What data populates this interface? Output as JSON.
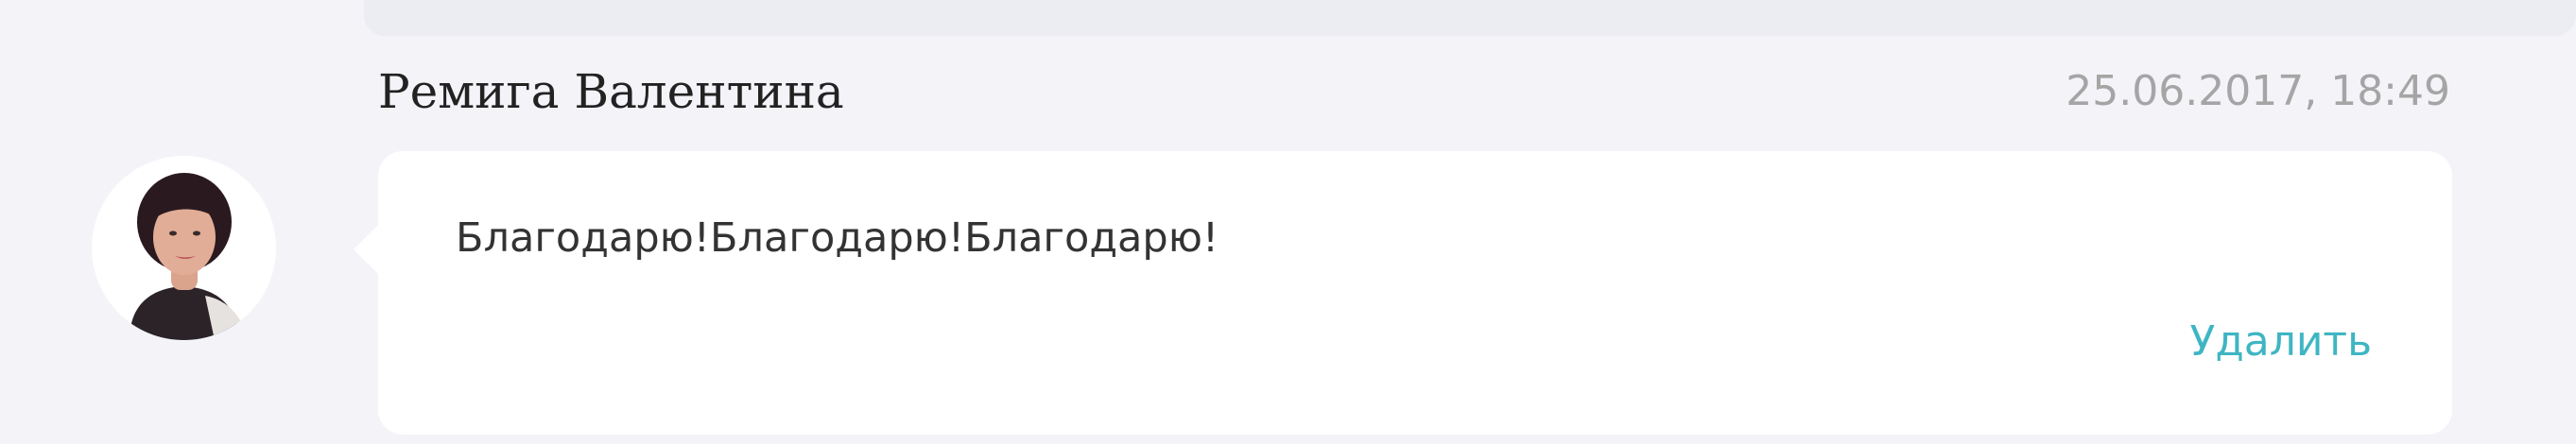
{
  "comment": {
    "author": "Ремига Валентина",
    "timestamp": "25.06.2017, 18:49",
    "text": "Благодарю!Благодарю!Благодарю!",
    "delete_label": "Удалить"
  },
  "colors": {
    "page_background": "#f3f3f8",
    "bubble_background": "#ffffff",
    "link": "#3fb5c3",
    "timestamp": "#a5a5a5",
    "author": "#222222",
    "text": "#333333"
  },
  "icons": {
    "avatar": "user-photo-avatar"
  }
}
